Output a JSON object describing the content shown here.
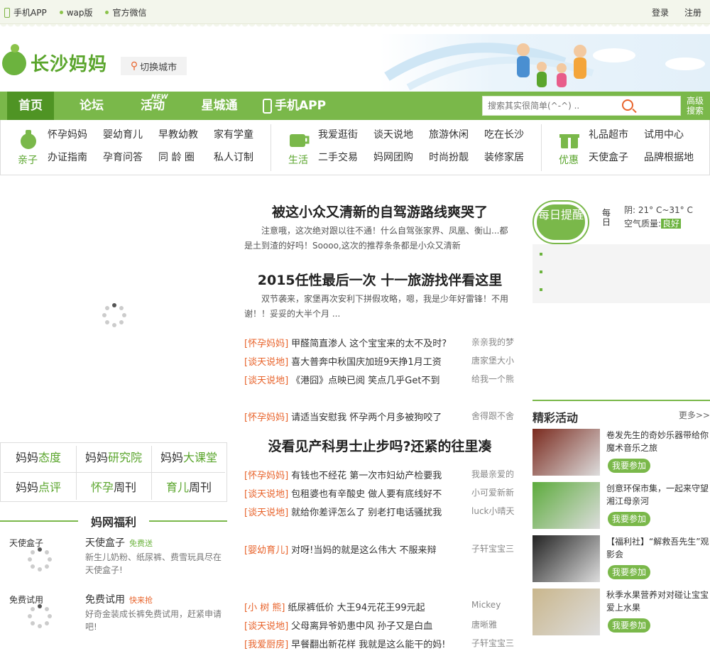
{
  "topbar": {
    "app": "手机APP",
    "wap": "wap版",
    "wechat": "官方微信",
    "login": "登录",
    "register": "注册"
  },
  "brand": {
    "name": "长沙妈妈",
    "city_switch": "切换城市"
  },
  "nav": {
    "items": [
      "首页",
      "论坛",
      "活动",
      "星城通",
      "手机APP"
    ],
    "new_badge": "NEW",
    "search_placeholder": "搜索其实很简单(^-^) ..",
    "advanced": "高级搜索"
  },
  "categories": [
    {
      "label": "亲子",
      "links": [
        "怀孕妈妈",
        "婴幼育儿",
        "早教幼教",
        "家有学童",
        "办证指南",
        "孕育问答",
        "同 龄 圈",
        "私人订制"
      ]
    },
    {
      "label": "生活",
      "links": [
        "我爱逛街",
        "谈天说地",
        "旅游休闲",
        "吃在长沙",
        "二手交易",
        "妈网团购",
        "时尚扮靓",
        "装修家居"
      ]
    },
    {
      "label": "优惠",
      "links": [
        "礼品超市",
        "试用中心",
        "天使盒子",
        "品牌根据地"
      ]
    }
  ],
  "mama_boxes": [
    {
      "pre": "妈妈",
      "hl": "态度",
      "post": ""
    },
    {
      "pre": "妈妈",
      "hl": "研究院",
      "post": ""
    },
    {
      "pre": "妈妈",
      "hl": "大课堂",
      "post": ""
    },
    {
      "pre": "妈妈",
      "hl": "点评",
      "post": ""
    },
    {
      "pre": "",
      "hl": "怀孕",
      "post": "周刊"
    },
    {
      "pre": "",
      "hl": "育儿",
      "post": "周刊"
    }
  ],
  "welfare": {
    "title": "妈网福利",
    "items": [
      {
        "label": "天使盒子",
        "title": "天使盒子",
        "tag": "免费送",
        "desc": "新生儿奶粉、纸尿裤、费雪玩具尽在天使盒子!"
      },
      {
        "label": "免费试用",
        "title": "免费试用",
        "tag": "快来抢",
        "desc": "好奇金装成长裤免费试用，赶紧申请吧!"
      }
    ]
  },
  "feature": [
    {
      "title": "被这小众又清新的自驾游路线爽哭了",
      "summary": "注意哦，这次绝对跟以往不通！什么自驾张家界、凤凰、衡山...都是土到渣的好吗！Soooo,这次的推荐条条都是小众又清新"
    },
    {
      "title": "2015任性最后一次 十一旅游找伴看这里",
      "summary": "双节袭来，家堡再次安利下拼假攻略，嗯，我是少年好雷锋！不用谢！！妥妥的大半个月 ..."
    },
    {
      "title": "没看见产科男士止步吗?还紧的往里凑",
      "summary": ""
    }
  ],
  "posts_a": [
    {
      "tag": "[怀孕妈妈]",
      "title": "甲醛简直渗人 这个宝宝来的太不及时?",
      "author": "亲亲我的梦"
    },
    {
      "tag": "[谈天说地]",
      "title": "喜大普奔中秋国庆加班9天挣1月工资",
      "author": "唐家堡大小"
    },
    {
      "tag": "[谈天说地]",
      "title": "《港囧》点映已阅 笑点几乎Get不到",
      "author": "给我一个熊"
    },
    {
      "tag": "[怀孕妈妈]",
      "title": "请适当安慰我 怀孕两个月多被狗咬了",
      "author": "舍得跟不舍"
    }
  ],
  "posts_b": [
    {
      "tag": "[怀孕妈妈]",
      "title": "有钱也不经花 第一次市妇幼产检要我",
      "author": "我最亲爱的"
    },
    {
      "tag": "[谈天说地]",
      "title": "包租婆也有辛酸史 做人要有底线好不",
      "author": "小可爱新新"
    },
    {
      "tag": "[谈天说地]",
      "title": "就给你差评怎么了 别老打电话骚扰我",
      "author": "luck小晴天"
    },
    {
      "tag": "[婴幼育儿]",
      "title": "对呀!当妈的就是这么伟大 不服来辩",
      "author": "子轩宝宝三"
    },
    {
      "tag": "[小 树 熊]",
      "title": "纸尿裤低价 大王94元花王99元起",
      "author": "Mickey"
    },
    {
      "tag": "[谈天说地]",
      "title": "父母离异爷奶患中风 孙子又是白血",
      "author": "唐晰雅"
    },
    {
      "tag": "[我爱厨房]",
      "title": "早餐翻出新花样 我就是这么能干的妈!",
      "author": "子轩宝宝三"
    }
  ],
  "daily": {
    "badge": "每日提醒",
    "day": "每日",
    "weather": "阴: 21° C~31° C",
    "air_label": "空气质量:",
    "air_value": "良好"
  },
  "activities": {
    "title": "精彩活动",
    "more": "更多>>",
    "join_label": "我要参加",
    "items": [
      {
        "title": "卷发先生的奇妙乐器带给你魔术音乐之旅",
        "color": "#7a2a1e"
      },
      {
        "title": "创意环保市集，一起来守望湘江母亲河",
        "color": "#5cab3c"
      },
      {
        "title": "【福利社】“解救吾先生”观影会",
        "color": "#222222"
      },
      {
        "title": "秋季水果营养对对碰让宝宝爱上水果",
        "color": "#c9b68c"
      }
    ]
  },
  "colors": {
    "brand_green": "#7ab84a",
    "dark_green": "#4f9424",
    "tag_orange": "#e8632b"
  }
}
